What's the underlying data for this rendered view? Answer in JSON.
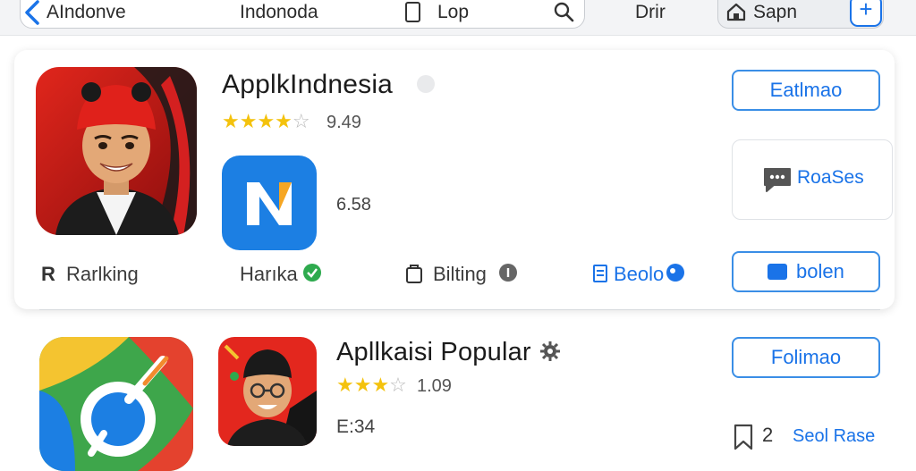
{
  "topbar": {
    "back_label": "AIndonve",
    "center_label": "Indonoda",
    "device_label": "Lop",
    "dir_label": "Drir",
    "sapn_label": "Sapn",
    "plus_label": "+"
  },
  "featured_app": {
    "title": "ApplkIndnesia",
    "stars": 4,
    "rating": "9.49",
    "secondary_value": "6.58",
    "edit_button": "Eatlmao",
    "message_button": "RoaSes",
    "bottom_button": "bolen",
    "meta": [
      {
        "icon": "r-icon",
        "label": "Rarlking"
      },
      {
        "icon": "badge-check-icon",
        "label": "Harıka"
      },
      {
        "icon": "bag-icon",
        "label": "Bilting"
      },
      {
        "icon": "doc-icon",
        "label": "Beolo"
      }
    ]
  },
  "popular_app": {
    "title": "Apllkaisi Popular",
    "stars": 3,
    "rating": "1.09",
    "secondary_value": "E:34",
    "follow_button": "Folimao",
    "bookmark_count": "2",
    "bookmark_label": "Seol Rase"
  },
  "colors": {
    "accent": "#1a73e8",
    "star": "#f4c20d",
    "muted": "#b9b9b9"
  }
}
